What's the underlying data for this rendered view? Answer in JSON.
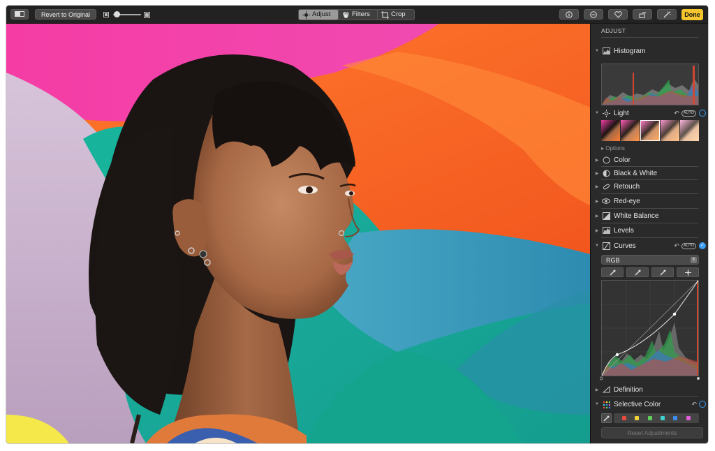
{
  "toolbar": {
    "revert_label": "Revert to Original",
    "tabs": [
      {
        "label": "Adjust",
        "active": true
      },
      {
        "label": "Filters",
        "active": false
      },
      {
        "label": "Crop",
        "active": false
      }
    ],
    "done_label": "Done",
    "right_icons": [
      "info-icon",
      "more-icon",
      "heart-icon",
      "rotate-icon",
      "magic-wand-icon"
    ]
  },
  "sidebar": {
    "title": "ADJUST",
    "histogram_label": "Histogram",
    "light_label": "Light",
    "light_auto": "AUTO",
    "options_label": "Options",
    "color_label": "Color",
    "bw_label": "Black & White",
    "retouch_label": "Retouch",
    "redeye_label": "Red-eye",
    "wb_label": "White Balance",
    "levels_label": "Levels",
    "curves_label": "Curves",
    "curves_auto": "AUTO",
    "curves_channel": "RGB",
    "definition_label": "Definition",
    "selective_color_label": "Selective Color",
    "reset_label": "Reset Adjustments"
  },
  "colors": {
    "accent": "#3a9ef5",
    "done": "#f5c62e",
    "selective_wells": [
      "#e84b3c",
      "#f2d43a",
      "#5fcf57",
      "#3fd0d0",
      "#3a8ef0",
      "#e05fd8"
    ]
  }
}
